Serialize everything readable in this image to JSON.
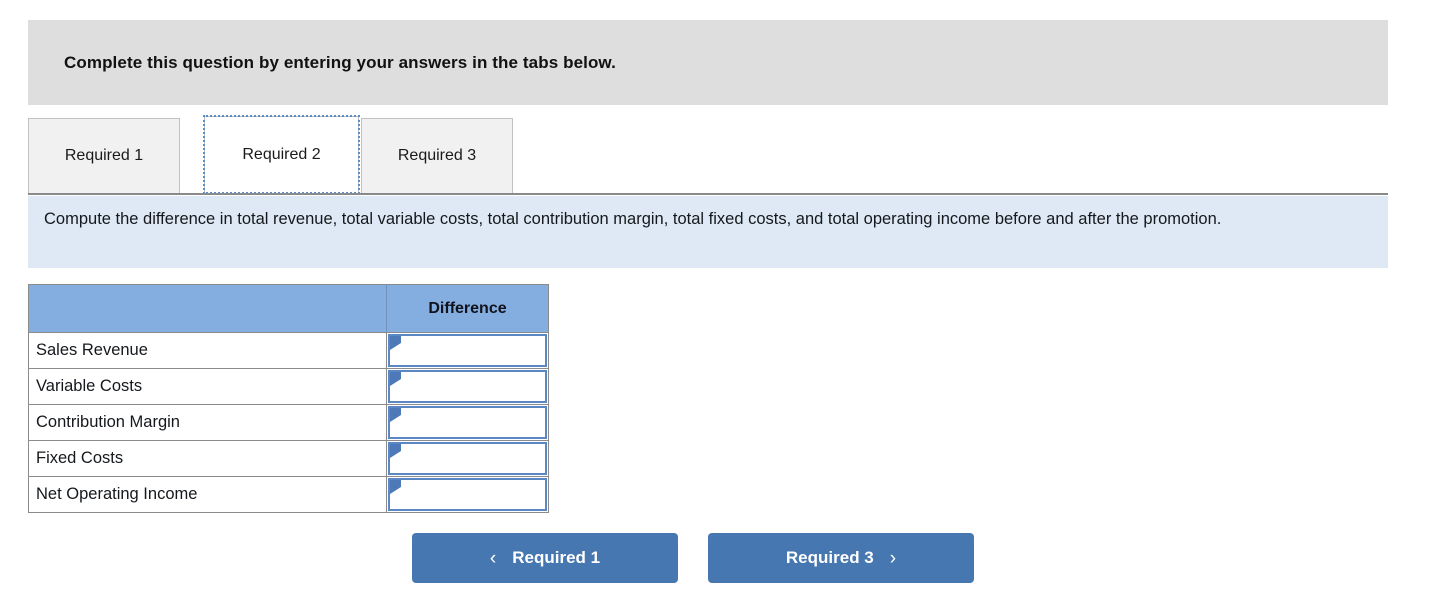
{
  "banner": {
    "text": "Complete this question by entering your answers in the tabs below."
  },
  "tabs": [
    {
      "label": "Required 1",
      "active": false
    },
    {
      "label": "Required 2",
      "active": true
    },
    {
      "label": "Required 3",
      "active": false
    }
  ],
  "instruction": {
    "text": "Compute the difference in total revenue, total variable costs, total contribution margin, total fixed costs, and total operating income before and after the promotion."
  },
  "table": {
    "headers": [
      "",
      "Difference"
    ],
    "rows": [
      {
        "label": "Sales Revenue",
        "value": "",
        "placeholder": ""
      },
      {
        "label": "Variable Costs",
        "value": "",
        "placeholder": ""
      },
      {
        "label": "Contribution Margin",
        "value": "",
        "placeholder": ""
      },
      {
        "label": "Fixed Costs",
        "value": "",
        "placeholder": ""
      },
      {
        "label": "Net Operating Income",
        "value": "",
        "placeholder": ""
      }
    ]
  },
  "nav": {
    "prev_label": "Required 1",
    "next_label": "Required 3",
    "prev_chevron": "‹",
    "next_chevron": "›"
  },
  "colors": {
    "banner_bg": "#dedede",
    "instruction_bg": "#dee9f5",
    "table_header_bg": "#85aee0",
    "button_bg": "#4777b0",
    "input_border": "#5b87c5",
    "marker": "#4d79b8",
    "tab_inactive_bg": "#f1f1f1",
    "tab_active_bg": "#ffffff",
    "focus_ring": "#5b8ec9"
  }
}
